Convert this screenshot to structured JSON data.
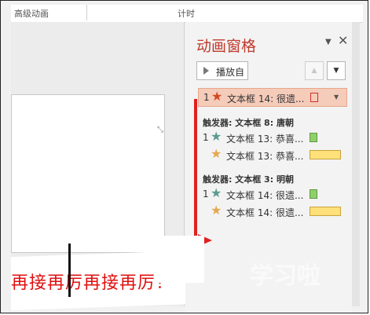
{
  "ribbon": {
    "left_label": "高级动画",
    "center_label": "计时"
  },
  "slide": {
    "text": "再接再厉再接再厉！",
    "handle_glyph": "⤡"
  },
  "pane": {
    "title": "动画窗格",
    "dropdown_glyph": "▼",
    "close_glyph": "✕",
    "play_button_label": "播放自",
    "move_up_glyph": "▲",
    "move_down_glyph": "▼",
    "items_top": [
      {
        "number": "1",
        "star": "red",
        "text": "文本框 14: 很遗...",
        "swatch": "outline-red",
        "selected": true,
        "caret": "▼"
      }
    ],
    "groups": [
      {
        "trigger": "触发器: 文本框 8: 唐朝",
        "items": [
          {
            "number": "1",
            "star": "teal",
            "text": "文本框 13: 恭喜...",
            "swatch": "green"
          },
          {
            "number": "",
            "star": "gold",
            "text": "文本框 13: 恭喜...",
            "swatch": "yellow"
          }
        ]
      },
      {
        "trigger": "触发器: 文本框 3: 明朝",
        "items": [
          {
            "number": "1",
            "star": "teal",
            "text": "文本框 14: 很遗...",
            "swatch": "green"
          },
          {
            "number": "",
            "star": "gold",
            "text": "文本框 14: 很遗...",
            "swatch": "yellow"
          }
        ]
      }
    ]
  },
  "watermark": "学习啦",
  "colors": {
    "title": "#c0392b",
    "selected_row": "#f5cbb9",
    "annotation_arrow": "#e02020",
    "slide_text": "#e01010"
  },
  "icons": {
    "star": "star-icon",
    "play": "play-triangle-icon",
    "close": "close-icon"
  }
}
